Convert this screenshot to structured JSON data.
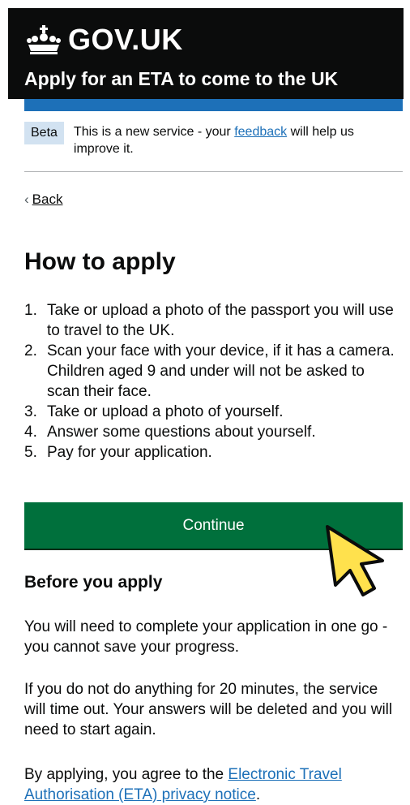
{
  "header": {
    "brand": "GOV.UK",
    "service_name": "Apply for an ETA to come to the UK"
  },
  "phase_banner": {
    "tag": "Beta",
    "text_before": "This is a new service - your ",
    "link": "feedback",
    "text_after": " will help us improve it."
  },
  "back_link": "Back",
  "page_title": "How to apply",
  "steps": [
    {
      "num": "1.",
      "text": "Take or upload a photo of the passport you will use to travel to the UK."
    },
    {
      "num": "2.",
      "text": "Scan your face with your device, if it has a camera. Children aged 9 and under will not be asked to scan their face."
    },
    {
      "num": "3.",
      "text": "Take or upload a photo of yourself."
    },
    {
      "num": "4.",
      "text": "Answer some questions about yourself."
    },
    {
      "num": "5.",
      "text": "Pay for your application."
    }
  ],
  "continue_label": "Continue",
  "before_heading": "Before you apply",
  "paragraphs": {
    "p1": "You will need to complete your application in one go - you cannot save your progress.",
    "p2": "If you do not do anything for 20 minutes, the service will time out. Your answers will be deleted and you will need to start again.",
    "p3_before": "By applying, you agree to the ",
    "p3_link": "Electronic Travel Authorisation (ETA) privacy notice",
    "p3_after": "."
  },
  "colors": {
    "header_bg": "#0b0c0c",
    "accent_blue": "#1d70b8",
    "button_green": "#00703c",
    "cursor_yellow": "#ffe14d"
  },
  "icons": {
    "crown": "crown-icon",
    "back": "chevron-left-icon",
    "cursor": "pointer-cursor-icon"
  }
}
